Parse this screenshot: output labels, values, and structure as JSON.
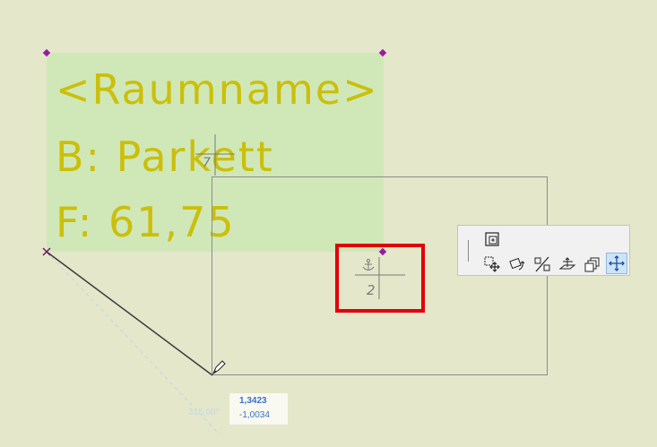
{
  "room_label": {
    "name_line": "<Raumname>",
    "floor_line": "B:  Parkett",
    "area_line": "F:  61,75"
  },
  "coordinate_tracker": {
    "x_value": "1,3423",
    "y_value": "-1,0034",
    "angle": "315,00°"
  },
  "marker": {
    "number": "2"
  },
  "toolbar": {
    "buttons": [
      {
        "icon": "copy-move-icon",
        "active": false
      },
      {
        "icon": "drag-move-icon",
        "active": false
      },
      {
        "icon": "rotate-icon",
        "active": false
      },
      {
        "icon": "mirror-icon",
        "active": false
      },
      {
        "icon": "elevate-icon",
        "active": false
      },
      {
        "icon": "multiply-icon",
        "active": false
      },
      {
        "icon": "move-icon",
        "active": true
      }
    ]
  },
  "colors": {
    "canvas": "#e4e7c9",
    "label_fill": "#d0e8b8",
    "label_text": "#cbbf0a",
    "handle": "#9a1aa8",
    "highlight": "#e0000a",
    "tracker_text": "#3a72c4"
  }
}
